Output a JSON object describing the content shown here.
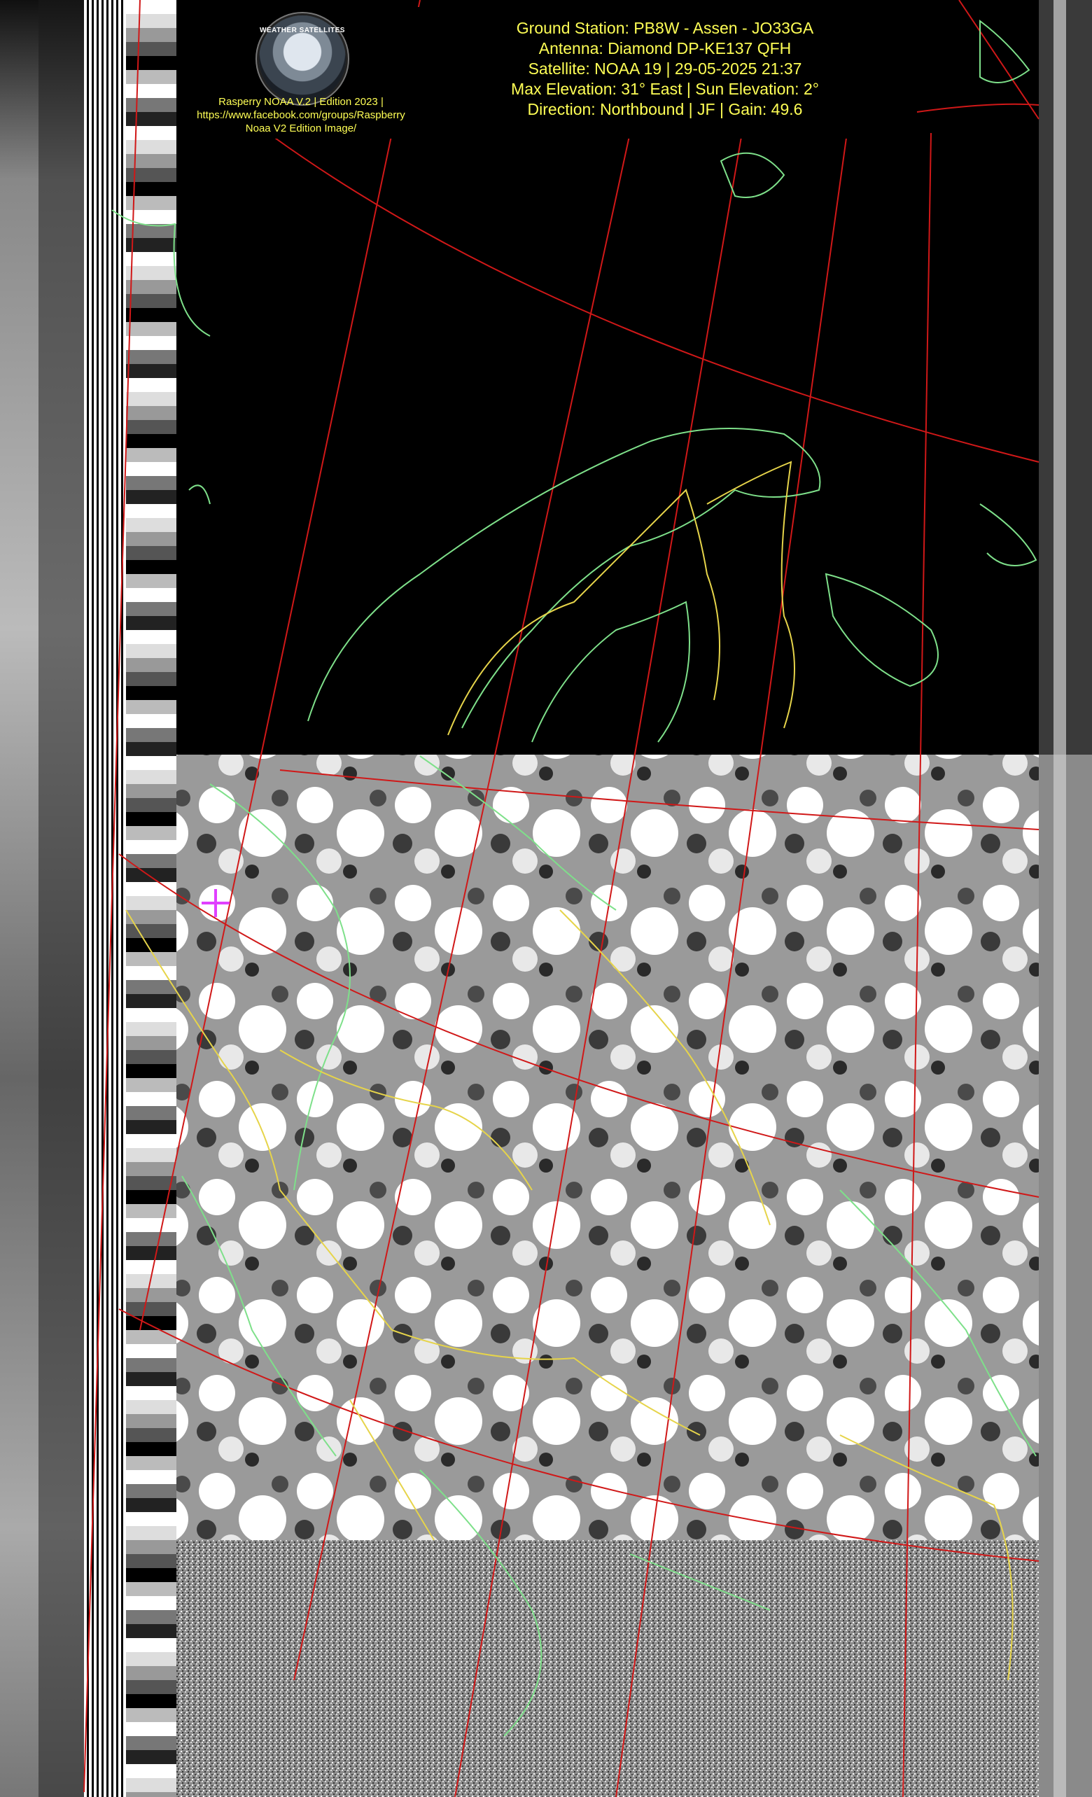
{
  "header": {
    "lines": [
      "Ground Station: PB8W - Assen - JO33GA",
      "Antenna: Diamond DP-KE137 QFH",
      "Satellite: NOAA 19 | 29-05-2025 21:37",
      "Max Elevation: 31° East | Sun Elevation: 2°",
      "Direction: Northbound | JF | Gain: 49.6"
    ]
  },
  "logo": {
    "badge_text": "WEATHER SATELLITES",
    "caption_lines": [
      "Rasperry NOAA V.2 | Edition 2023 |",
      "https://www.facebook.com/groups/Raspberry",
      "Noaa V2 Edition Image/"
    ]
  },
  "colors": {
    "text": "#ffff55",
    "coastline": "#7ee08a",
    "border": "#e6d44a",
    "graticule": "#d01818",
    "marker": "#e040ff"
  },
  "image": {
    "type": "NOAA APT satellite weather image",
    "marker_icon": "crosshair-icon"
  }
}
